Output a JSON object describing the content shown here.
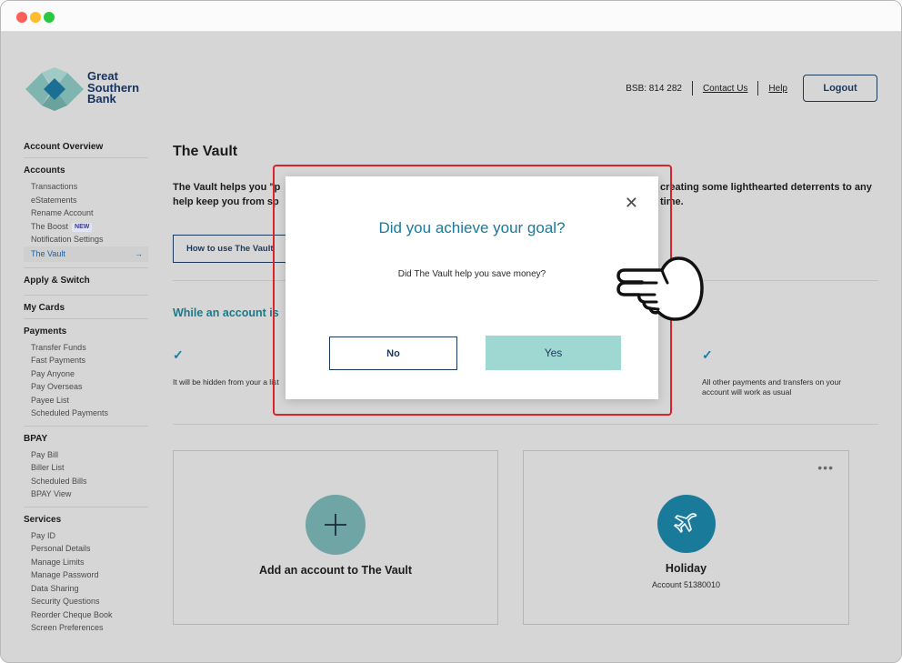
{
  "brand": {
    "logo_line1": "Great",
    "logo_line2": "Southern",
    "logo_line3": "Bank",
    "colors": {
      "teal": "#1a7a9a",
      "navy": "#1b3a5c",
      "yes_button": "#9fd8d3",
      "highlight": "#d9242b"
    }
  },
  "header": {
    "bsb": "BSB: 814 282",
    "contact": "Contact Us",
    "help": "Help",
    "logout": "Logout"
  },
  "sidebar": {
    "account_overview": "Account Overview",
    "accounts": {
      "title": "Accounts",
      "items": [
        "Transactions",
        "eStatements",
        "Rename Account",
        "The Boost",
        "Notification Settings",
        "The Vault"
      ],
      "boost_badge": "NEW",
      "active_arrow": "→"
    },
    "apply_switch": "Apply & Switch",
    "my_cards": "My Cards",
    "payments": {
      "title": "Payments",
      "items": [
        "Transfer Funds",
        "Fast Payments",
        "Pay Anyone",
        "Pay Overseas",
        "Payee List",
        "Scheduled Payments"
      ]
    },
    "bpay": {
      "title": "BPAY",
      "items": [
        "Pay Bill",
        "Biller List",
        "Scheduled Bills",
        "BPAY View"
      ]
    },
    "services": {
      "title": "Services",
      "items": [
        "Pay ID",
        "Personal Details",
        "Manage Limits",
        "Manage Password",
        "Data Sharing",
        "Security Questions",
        "Reorder Cheque Book",
        "Screen Preferences"
      ]
    }
  },
  "main": {
    "title": "The Vault",
    "intro_left": "The Vault helps you \"p help keep you from sp",
    "intro_right": "creating some lighthearted deterrents to any time.",
    "how_to_button": "How to use The Vault",
    "while_heading": "While an account is",
    "check_glyph": "✓",
    "hidden_text": "It will be hidden from your a list",
    "payments_text": "All other payments and transfers on your account will work as usual",
    "add_card_label": "Add an account to The Vault",
    "vault_card": {
      "name": "Holiday",
      "account": "Account 51380010",
      "menu": "•••"
    }
  },
  "modal": {
    "close": "✕",
    "title": "Did you achieve your goal?",
    "subtitle": "Did The Vault help you save money?",
    "no": "No",
    "yes": "Yes"
  }
}
